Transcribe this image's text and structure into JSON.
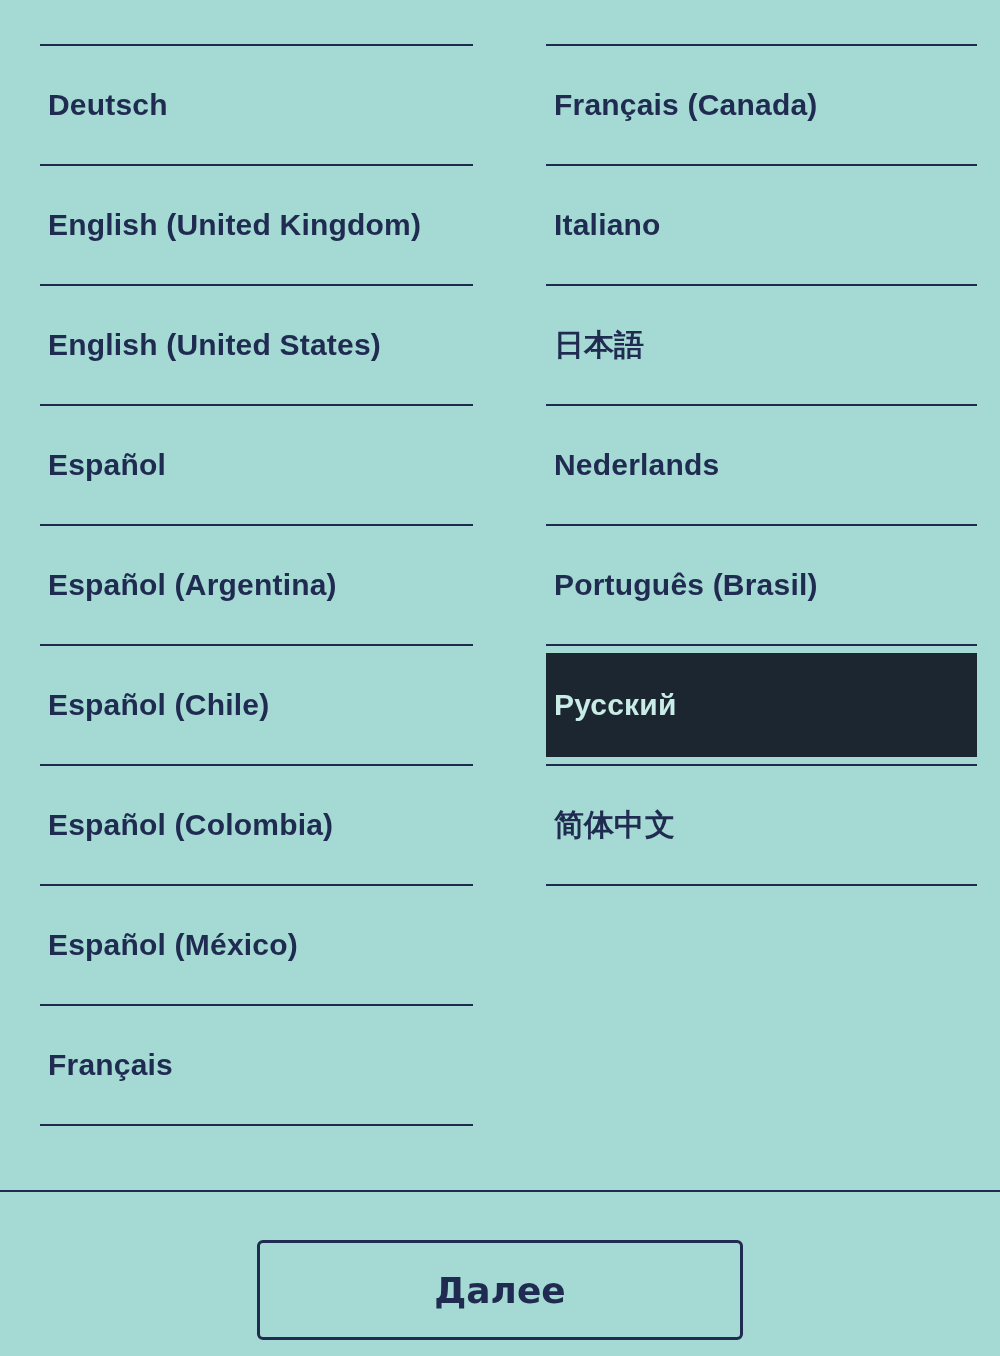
{
  "columns": [
    {
      "items": [
        {
          "label": "Deutsch",
          "selected": false
        },
        {
          "label": "English (United Kingdom)",
          "selected": false
        },
        {
          "label": "English (United States)",
          "selected": false
        },
        {
          "label": "Español",
          "selected": false
        },
        {
          "label": "Español (Argentina)",
          "selected": false
        },
        {
          "label": "Español (Chile)",
          "selected": false
        },
        {
          "label": "Español (Colombia)",
          "selected": false
        },
        {
          "label": "Español (México)",
          "selected": false
        },
        {
          "label": "Français",
          "selected": false
        }
      ]
    },
    {
      "items": [
        {
          "label": "Français (Canada)",
          "selected": false
        },
        {
          "label": "Italiano",
          "selected": false
        },
        {
          "label": "日本語",
          "selected": false
        },
        {
          "label": "Nederlands",
          "selected": false
        },
        {
          "label": "Português (Brasil)",
          "selected": false
        },
        {
          "label": "Русский",
          "selected": true
        },
        {
          "label": "简体中文",
          "selected": false
        }
      ]
    }
  ],
  "next_button": {
    "label": "Далее"
  }
}
